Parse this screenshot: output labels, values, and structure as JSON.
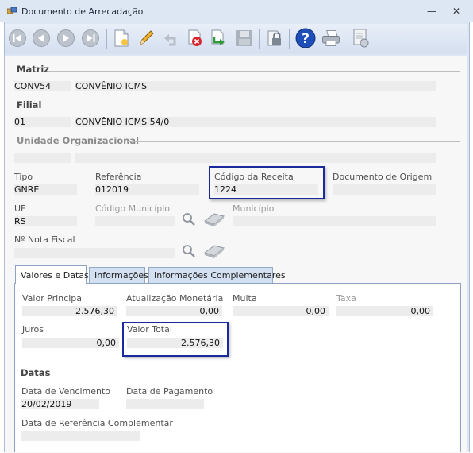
{
  "window": {
    "title": "Documento de Arrecadação",
    "minimize": "—",
    "close": "✕"
  },
  "toolbar": {
    "buttons": [
      {
        "name": "first-record",
        "icon": "first-record-icon"
      },
      {
        "name": "previous-record",
        "icon": "previous-record-icon"
      },
      {
        "name": "next-record",
        "icon": "next-record-icon"
      },
      {
        "name": "last-record",
        "icon": "last-record-icon"
      },
      {
        "name": "new-document",
        "icon": "new-document-icon"
      },
      {
        "name": "edit",
        "icon": "pencil-icon"
      },
      {
        "name": "undo",
        "icon": "undo-icon"
      },
      {
        "name": "delete",
        "icon": "delete-icon"
      },
      {
        "name": "confirm",
        "icon": "confirm-arrow-icon"
      },
      {
        "name": "save",
        "icon": "save-icon"
      },
      {
        "name": "lock",
        "icon": "lock-icon"
      },
      {
        "name": "help",
        "icon": "help-icon"
      },
      {
        "name": "print",
        "icon": "printer-icon"
      },
      {
        "name": "report",
        "icon": "report-icon"
      }
    ]
  },
  "matriz": {
    "section": "Matriz",
    "code": "CONV54",
    "name": "CONVÊNIO ICMS"
  },
  "filial": {
    "section": "Filial",
    "code": "01",
    "name": "CONVÊNIO ICMS 54/0"
  },
  "unidade": {
    "section": "Unidade Organizacional",
    "code": "",
    "name": ""
  },
  "tipo": {
    "label": "Tipo",
    "value": "GNRE"
  },
  "referencia": {
    "label": "Referência",
    "value": "012019"
  },
  "codigo_receita": {
    "label": "Código da Receita",
    "value": "1224"
  },
  "documento_origem": {
    "label": "Documento de Origem",
    "value": ""
  },
  "uf": {
    "label": "UF",
    "value": "RS"
  },
  "codigo_municipio": {
    "label": "Código Município",
    "value": ""
  },
  "municipio": {
    "label": "Município",
    "value": ""
  },
  "nota_fiscal": {
    "label": "Nº Nota Fiscal",
    "value": ""
  },
  "tabs": [
    {
      "label": "Valores e Datas",
      "active": true
    },
    {
      "label": "Informações",
      "active": false
    },
    {
      "label": "Informações Complementares",
      "active": false
    }
  ],
  "valores": {
    "principal": {
      "label": "Valor Principal",
      "value": "2.576,30"
    },
    "atualizacao": {
      "label": "Atualização Monetária",
      "value": "0,00"
    },
    "multa": {
      "label": "Multa",
      "value": "0,00"
    },
    "taxa": {
      "label": "Taxa",
      "value": "0,00"
    },
    "juros": {
      "label": "Juros",
      "value": "0,00"
    },
    "total": {
      "label": "Valor Total",
      "value": "2.576,30"
    }
  },
  "datas": {
    "section": "Datas",
    "vencimento": {
      "label": "Data de Vencimento",
      "value": "20/02/2019"
    },
    "pagamento": {
      "label": "Data de Pagamento",
      "value": ""
    },
    "referencia_complementar": {
      "label": "Data de Referência Complementar",
      "value": ""
    }
  },
  "colors": {
    "highlight": "#1b2a9b",
    "titlebar": "#dde6f3",
    "field": "#ececec"
  }
}
